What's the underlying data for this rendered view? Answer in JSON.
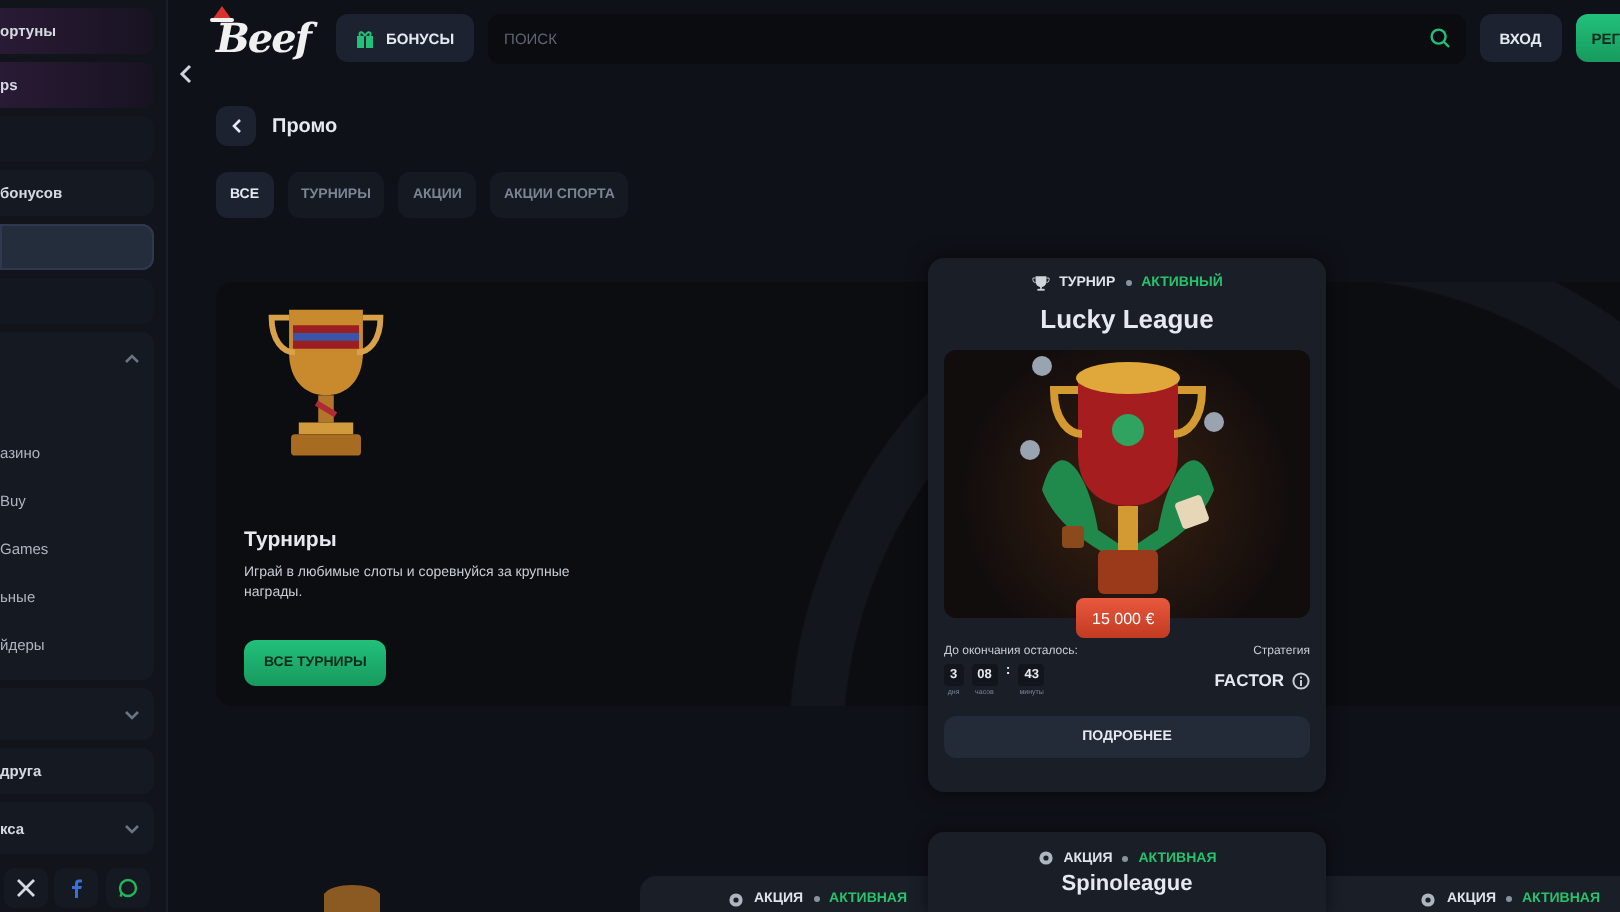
{
  "sidebar": {
    "items": [
      {
        "kind": "promo",
        "label": "ортуны",
        "selected": false
      },
      {
        "kind": "promo",
        "label": "ps",
        "selected": false
      },
      {
        "kind": "blank",
        "selected": false
      },
      {
        "kind": "link",
        "label": "бонусов",
        "selected": false
      },
      {
        "kind": "blank",
        "selected": true
      },
      {
        "kind": "blank",
        "selected": false
      },
      {
        "kind": "group",
        "expanded": true,
        "selected": false,
        "children": [
          {
            "label": "азино"
          },
          {
            "label": "Buy"
          },
          {
            "label": "Games"
          },
          {
            "label": "ьные"
          },
          {
            "label": "йдеры"
          }
        ]
      },
      {
        "kind": "group",
        "expanded": false,
        "selected": false
      },
      {
        "kind": "link",
        "label": "друга",
        "selected": false
      },
      {
        "kind": "group",
        "expanded": false,
        "label": "кса",
        "selected": false
      }
    ],
    "social": [
      {
        "kind": "x"
      },
      {
        "kind": "facebook"
      },
      {
        "kind": "whatsapp"
      }
    ]
  },
  "topbar": {
    "logo": "Beef",
    "bonus_button": "БОНУСЫ",
    "search": {
      "placeholder": "ПОИСК"
    },
    "login_button": "ВХОД",
    "register_button": "РЕГ"
  },
  "page": {
    "title": "Промо"
  },
  "filters": [
    {
      "label": "ВСЕ",
      "selected": true
    },
    {
      "label": "ТУРНИРЫ",
      "selected": false
    },
    {
      "label": "АКЦИИ",
      "selected": false
    },
    {
      "label": "АКЦИИ СПОРТА",
      "selected": false
    }
  ],
  "hero": {
    "title": "Турниры",
    "description": "Играй в любимые слоты и соревнуйся за крупные награды.",
    "button": "ВСЕ ТУРНИРЫ"
  },
  "tournament_card": {
    "type": "ТУРНИР",
    "status": "АКТИВНЫЙ",
    "title": "Lucky League",
    "prize": "15 000 €",
    "countdown_label": "До окончания осталось:",
    "countdown": [
      {
        "value": "3",
        "unit": "дня"
      },
      {
        "value": "08",
        "unit": "часов"
      },
      {
        "separator": ":",
        "value": "43",
        "unit": "минуты"
      }
    ],
    "strategy_label": "Стратегия",
    "strategy": "FACTOR",
    "button": "ПОДРОБНЕЕ"
  },
  "promo_cards": [
    {
      "type": "АКЦИЯ",
      "status": "АКТИВНАЯ",
      "title": "Spinoleague"
    },
    {
      "type": "АКЦИЯ",
      "status": "АКТИВНАЯ"
    },
    {
      "type": "АКЦИЯ",
      "status": "АКТИВНАЯ"
    }
  ]
}
